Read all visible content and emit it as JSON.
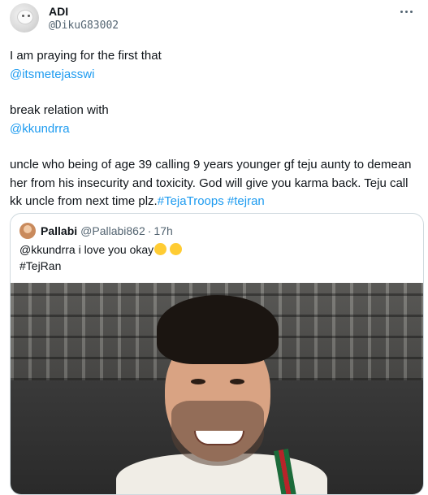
{
  "author": {
    "name": "ADI",
    "handle": "@DikuG83002"
  },
  "tweet": {
    "line1": "I am praying for the first that",
    "mention1": "@itsmetejasswi",
    "line2": "break relation with",
    "mention2": "@kkundrra",
    "para3": "uncle who being of age 39 calling 9 years younger gf teju aunty to demean her from his insecurity and toxicity. God will give you karma back. Teju call kk uncle from next time plz.",
    "hashtag1": "#TejaTroops",
    "hashtag2": "#tejran"
  },
  "quote": {
    "name": "Pallabi",
    "handle": "@Pallabi862",
    "separator": "·",
    "time": "17h",
    "text_line1": "@kkundrra i love you okay",
    "text_line2": "#TejRan",
    "emojis": [
      "smiling-face-with-hearts",
      "face-blowing-kiss"
    ]
  },
  "icons": {
    "more": "more-horizontal-icon"
  }
}
